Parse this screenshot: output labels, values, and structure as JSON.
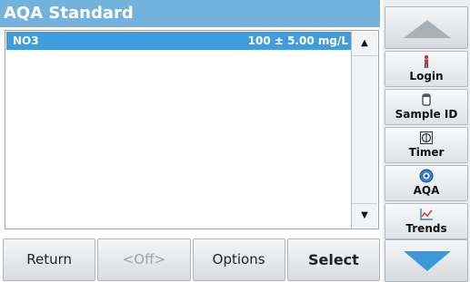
{
  "title": "AQA Standard",
  "list": {
    "rows": [
      {
        "name": "NO3",
        "value": "100 ± 5.00 mg/L"
      }
    ],
    "scroll_up": "▲",
    "scroll_down": "▼"
  },
  "bottom_buttons": {
    "return": "Return",
    "off": "<Off>",
    "options": "Options",
    "select": "Select"
  },
  "sidebar": {
    "items": [
      {
        "label": "Login",
        "icon": "person-icon"
      },
      {
        "label": "Sample ID",
        "icon": "sample-vial-icon"
      },
      {
        "label": "Timer",
        "icon": "timer-icon"
      },
      {
        "label": "AQA",
        "icon": "aqa-icon"
      },
      {
        "label": "Trends",
        "icon": "trends-chart-icon"
      }
    ]
  },
  "colors": {
    "title_bar": "#73b2dc",
    "selected_row": "#3f9ddf",
    "nav_arrow_up": "#a9b0b6",
    "nav_arrow_down": "#3a9ad9"
  }
}
